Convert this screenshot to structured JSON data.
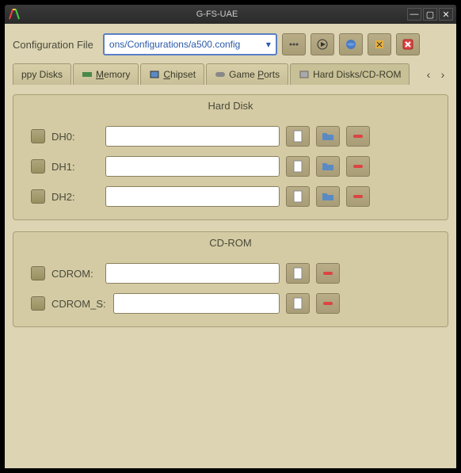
{
  "window": {
    "title": "G-FS-UAE"
  },
  "config": {
    "label": "Configuration File",
    "value": "ons/Configurations/a500.config"
  },
  "tabs": {
    "items": [
      {
        "label": "ppy Disks"
      },
      {
        "label": "Memory"
      },
      {
        "label": "Chipset"
      },
      {
        "label": "Game Ports"
      },
      {
        "label": "Hard Disks/CD-ROM"
      }
    ]
  },
  "panels": {
    "hdd": {
      "title": "Hard Disk",
      "rows": [
        {
          "label": "DH0:",
          "value": ""
        },
        {
          "label": "DH1:",
          "value": ""
        },
        {
          "label": "DH2:",
          "value": ""
        }
      ]
    },
    "cdrom": {
      "title": "CD-ROM",
      "rows": [
        {
          "label": "CDROM:",
          "value": ""
        },
        {
          "label": "CDROM_S:",
          "value": ""
        }
      ]
    }
  }
}
